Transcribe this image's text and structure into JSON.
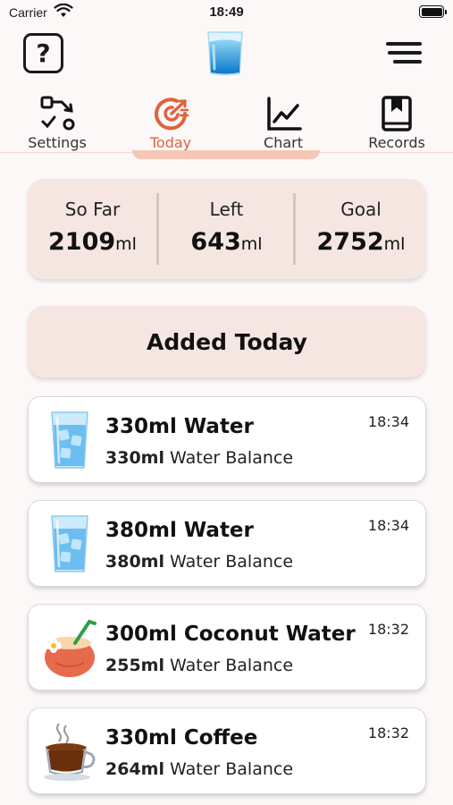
{
  "status_bar": {
    "carrier": "Carrier",
    "time": "18:49"
  },
  "help_label": "?",
  "tabs": [
    {
      "label": "Settings",
      "icon": "settings-flow-icon"
    },
    {
      "label": "Today",
      "icon": "today-target-icon"
    },
    {
      "label": "Chart",
      "icon": "chart-line-icon"
    },
    {
      "label": "Records",
      "icon": "records-book-icon"
    }
  ],
  "active_tab": "Today",
  "summary": {
    "so_far": {
      "label": "So Far",
      "value": "2109",
      "unit": "ml"
    },
    "left": {
      "label": "Left",
      "value": "643",
      "unit": "ml"
    },
    "goal": {
      "label": "Goal",
      "value": "2752",
      "unit": "ml"
    }
  },
  "added_today_title": "Added Today",
  "entries": [
    {
      "title": "330ml Water",
      "balance": "330ml",
      "balance_text": "Water Balance",
      "time": "18:34",
      "icon": "water-glass-icon"
    },
    {
      "title": "380ml Water",
      "balance": "380ml",
      "balance_text": "Water Balance",
      "time": "18:34",
      "icon": "water-glass-icon"
    },
    {
      "title": "300ml Coconut Water",
      "balance": "255ml",
      "balance_text": "Water Balance",
      "time": "18:32",
      "icon": "coconut-icon"
    },
    {
      "title": "330ml Coffee",
      "balance": "264ml",
      "balance_text": "Water Balance",
      "time": "18:32",
      "icon": "coffee-cup-icon"
    }
  ],
  "colors": {
    "accent": "#e0623e",
    "card_bg": "#f5e6e1",
    "background": "#fbf8f7"
  }
}
